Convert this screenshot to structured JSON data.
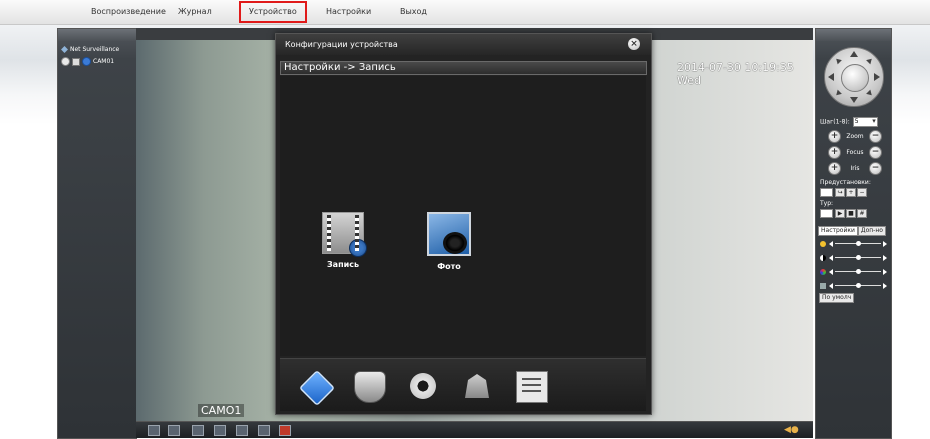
{
  "menu": {
    "items": [
      {
        "label": "Воспроизведение"
      },
      {
        "label": "Журнал"
      },
      {
        "label": "Устройство",
        "active": true
      },
      {
        "label": "Настройки"
      },
      {
        "label": "Выход"
      }
    ],
    "active_highlight_color": "#e01a1a"
  },
  "tree": {
    "root_label": "Net Surveillance",
    "camera_label": "CAM01"
  },
  "video": {
    "timestamp": "2014-07-30 10:19:35 Wed",
    "camera_overlay": "CAMO1"
  },
  "dialog": {
    "title": "Конфигурации устройства",
    "breadcrumb": "Настройки -> Запись",
    "tiles": [
      {
        "label": "Запись",
        "icon": "film-gear-icon"
      },
      {
        "label": "Фото",
        "icon": "camera-icon"
      }
    ],
    "footer_icons": [
      "record-settings-icon",
      "alarm-shield-icon",
      "system-gear-icon",
      "tools-icon",
      "info-checklist-icon"
    ]
  },
  "ptz": {
    "step_label": "Шаг(1-8):",
    "step_value": "5",
    "zoom_label": "Zoom",
    "focus_label": "Focus",
    "iris_label": "Iris",
    "preset_label": "Предустановки:",
    "tour_label": "Тур:",
    "tab_settings": "Настройки",
    "tab_more": "Доп-но",
    "default_button": "По умолч"
  }
}
